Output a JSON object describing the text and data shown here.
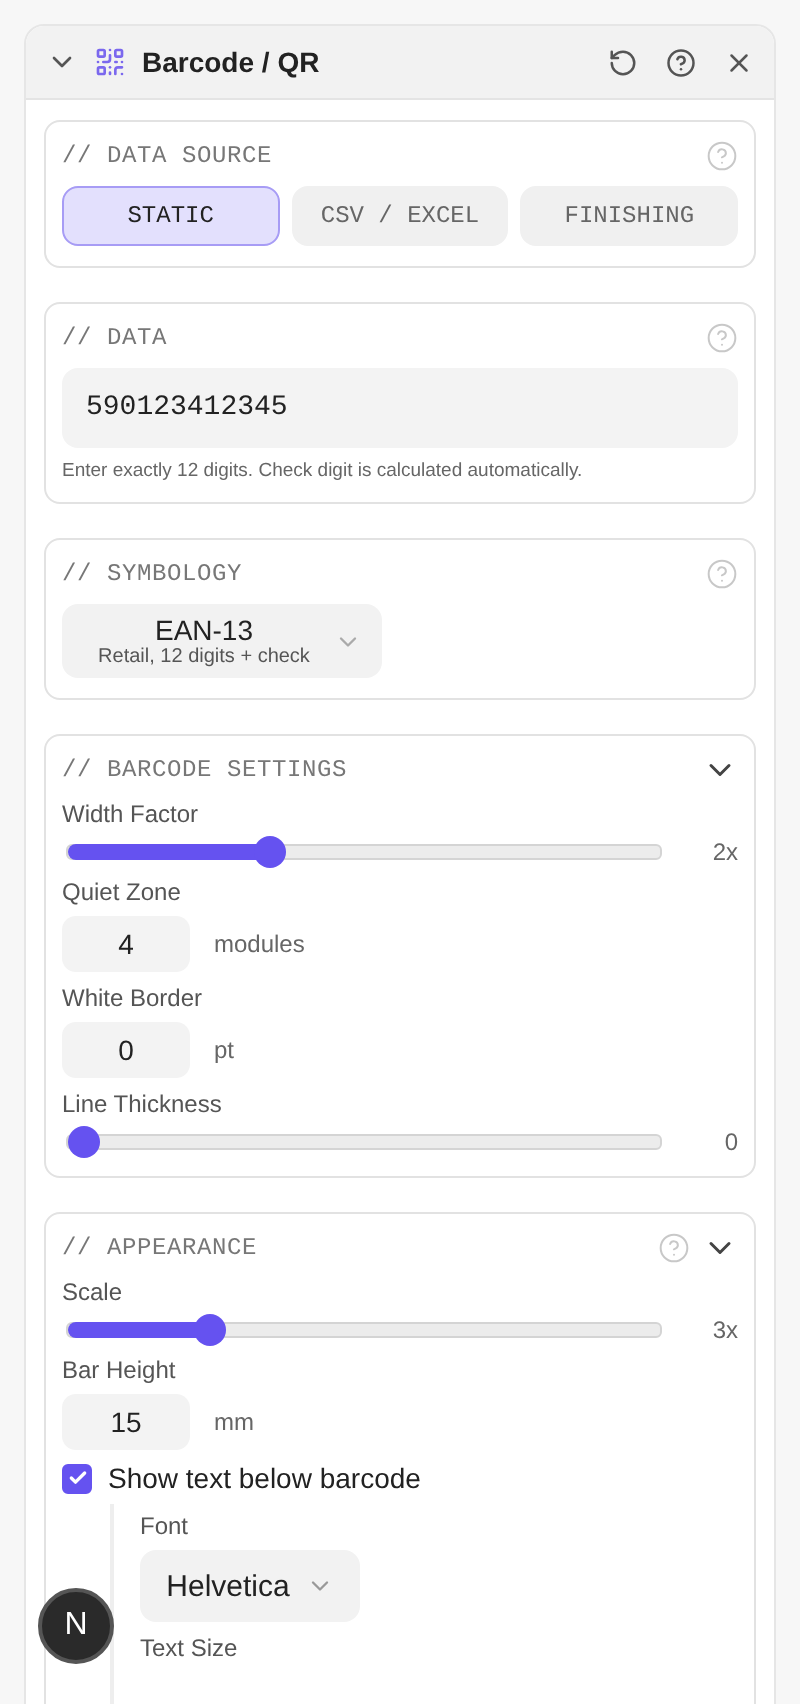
{
  "panel": {
    "title": "Barcode / QR",
    "expanded": true
  },
  "sections": [
    {
      "kind": "tabs",
      "title": "// DATA SOURCE",
      "help": true,
      "tabs": [
        {
          "label": "STATIC",
          "selected": true
        },
        {
          "label": "CSV / EXCEL",
          "selected": false
        },
        {
          "label": "FINISHING",
          "selected": false
        }
      ]
    },
    {
      "kind": "text",
      "title": "// DATA",
      "help": true,
      "value": "590123412345",
      "hint": "Enter exactly 12 digits. Check digit is calculated automatically."
    },
    {
      "kind": "select",
      "title": "// SYMBOLOGY",
      "help": true,
      "value": "EAN-13",
      "sub": "Retail, 12 digits + check"
    },
    {
      "kind": "controls",
      "title": "// BARCODE SETTINGS",
      "help": false,
      "expanded": true,
      "controls": [
        {
          "kind": "slider",
          "label": "Width Factor",
          "level": 0.34,
          "reading": "2x"
        },
        {
          "kind": "number",
          "label": "Quiet Zone",
          "value": "4",
          "unit": "modules"
        },
        {
          "kind": "number",
          "label": "White Border",
          "value": "0",
          "unit": "pt"
        },
        {
          "kind": "slider",
          "label": "Line Thickness",
          "level": 0,
          "reading": "0"
        }
      ]
    },
    {
      "kind": "controls",
      "title": "// APPEARANCE",
      "help": true,
      "expanded": true,
      "controls": [
        {
          "kind": "slider",
          "label": "Scale",
          "level": 0.24,
          "reading": "3x"
        },
        {
          "kind": "number",
          "label": "Bar Height",
          "value": "15",
          "unit": "mm"
        },
        {
          "kind": "checkbox",
          "label": "Show text below barcode",
          "checked": true,
          "children": [
            {
              "kind": "select",
              "label": "Font",
              "value": "Helvetica"
            },
            {
              "kind": "heading",
              "label": "Text Size"
            }
          ]
        }
      ]
    }
  ],
  "fab": {
    "label": "N"
  }
}
